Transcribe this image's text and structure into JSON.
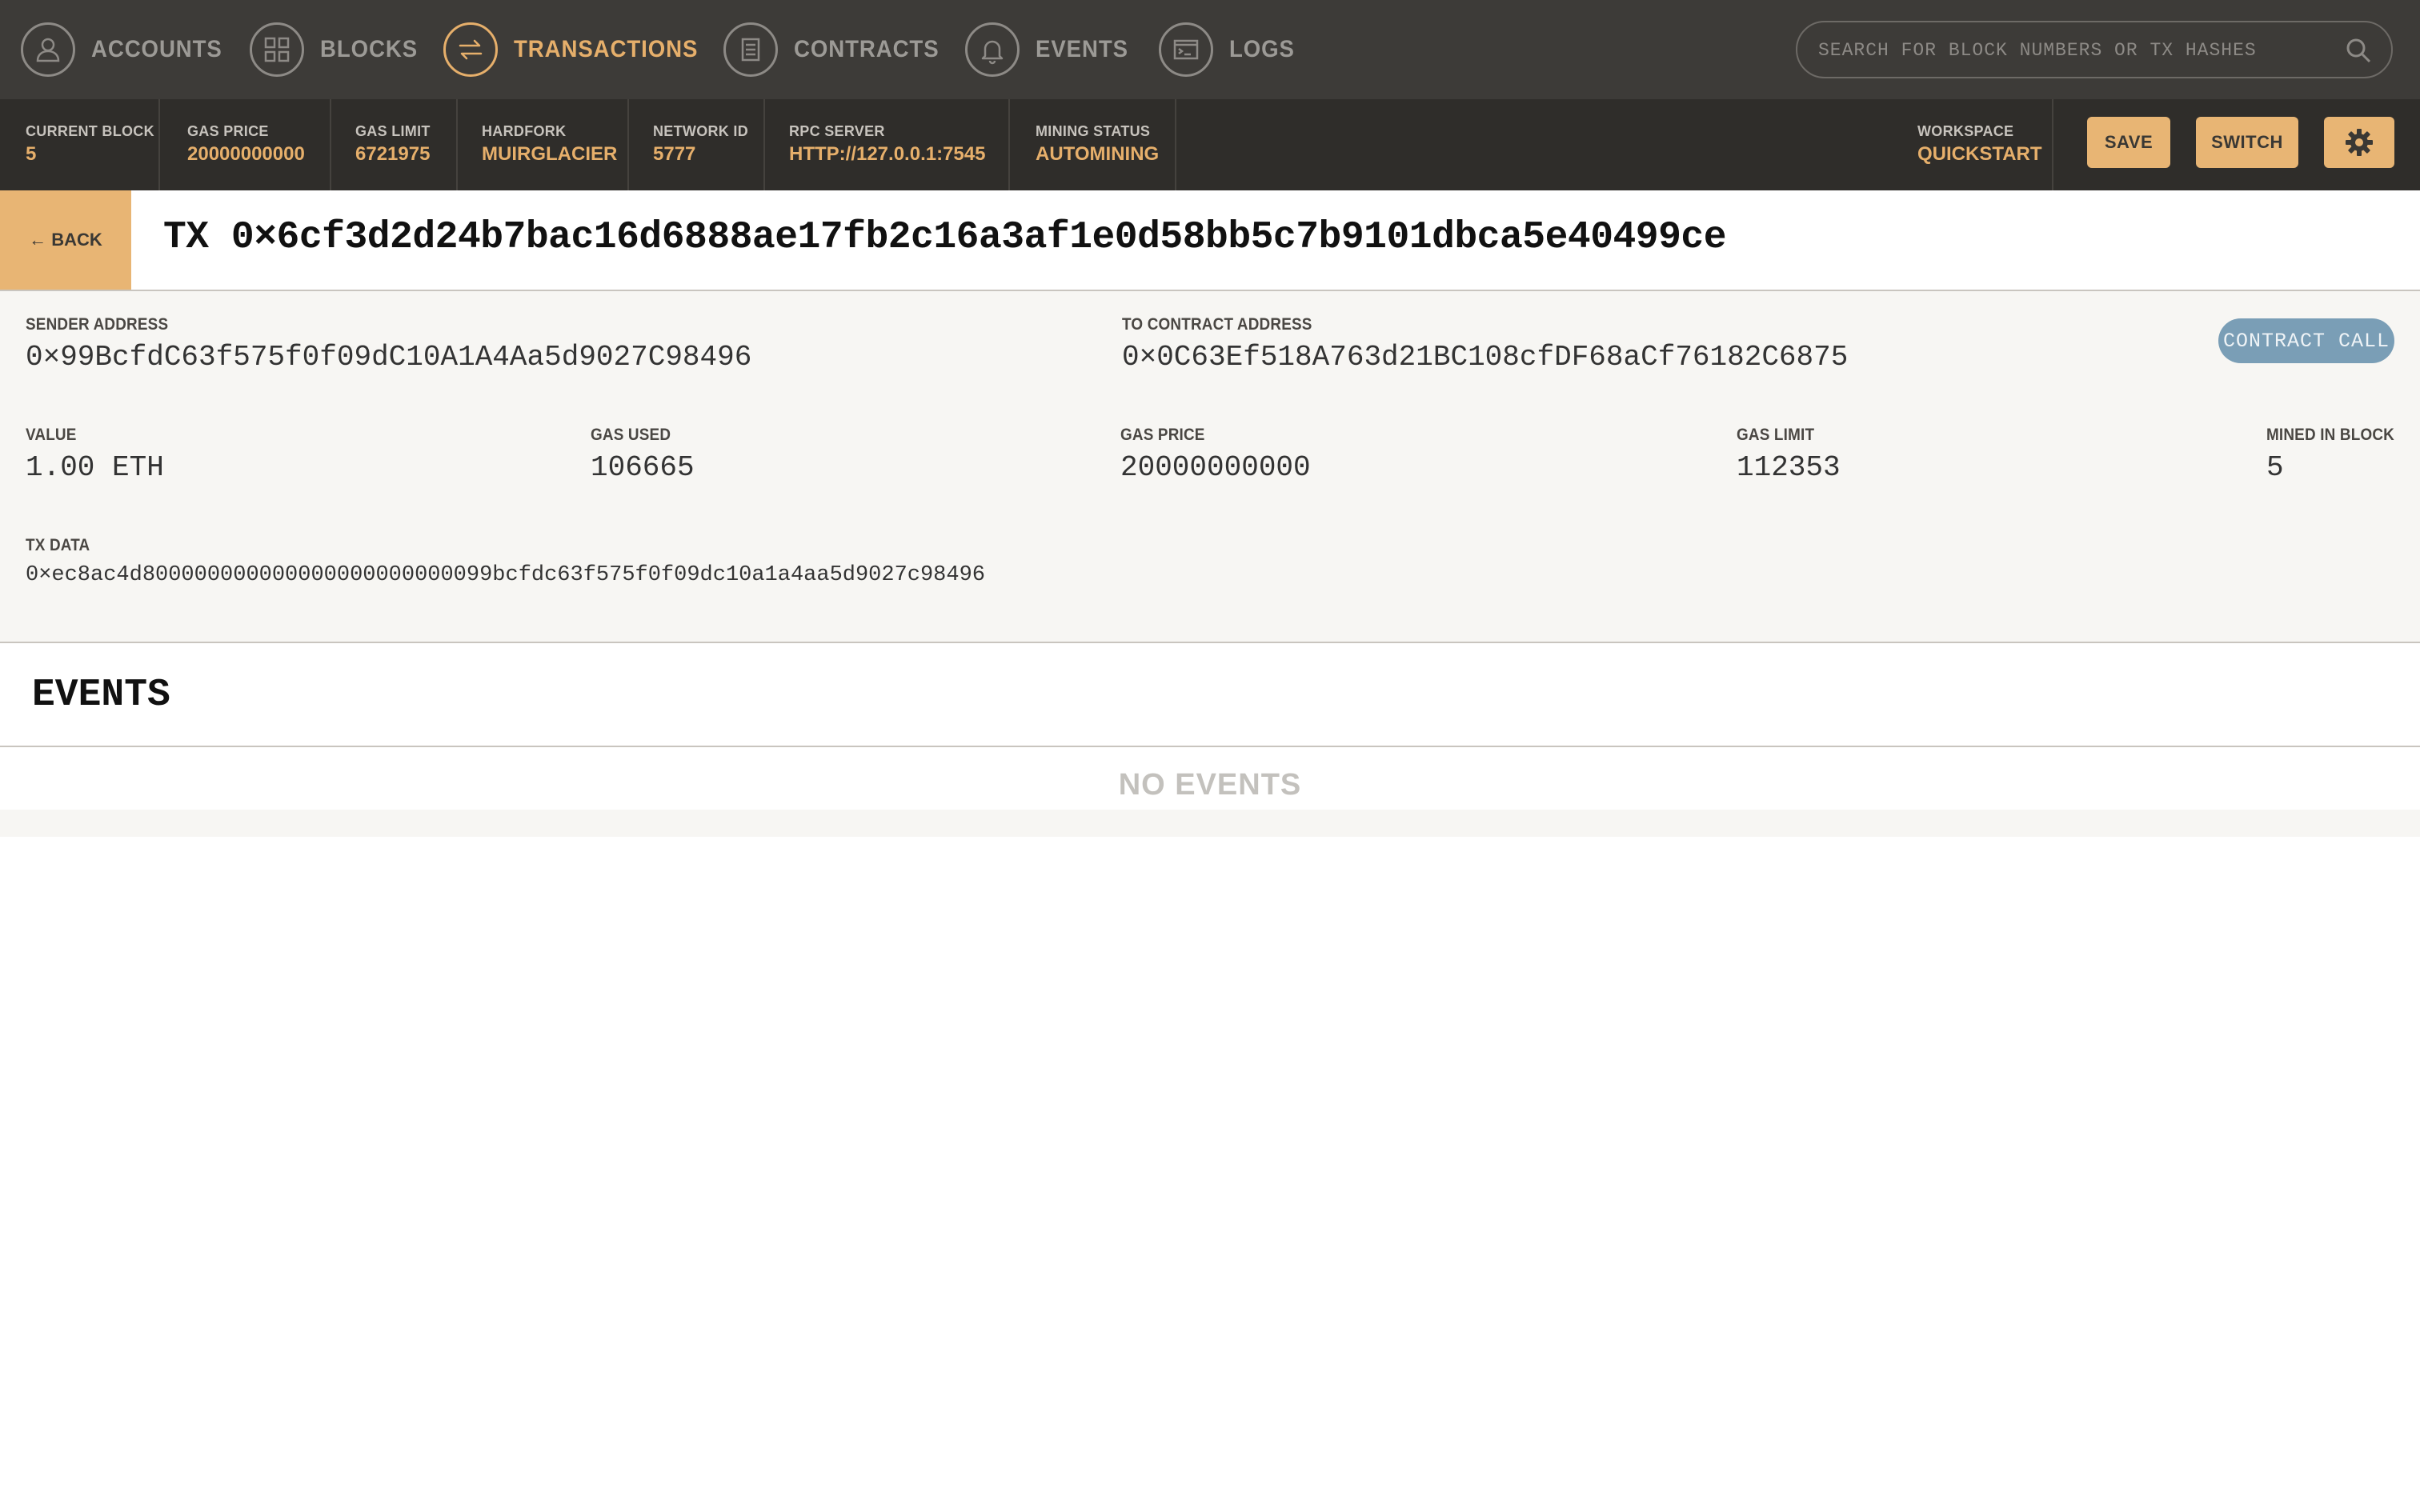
{
  "nav": {
    "items": [
      {
        "label": "ACCOUNTS",
        "icon": "account-icon"
      },
      {
        "label": "BLOCKS",
        "icon": "blocks-icon"
      },
      {
        "label": "TRANSACTIONS",
        "icon": "transactions-icon"
      },
      {
        "label": "CONTRACTS",
        "icon": "contracts-icon"
      },
      {
        "label": "EVENTS",
        "icon": "bell-icon"
      },
      {
        "label": "LOGS",
        "icon": "logs-icon"
      }
    ],
    "active": "TRANSACTIONS",
    "search_placeholder": "SEARCH FOR BLOCK NUMBERS OR TX HASHES"
  },
  "status": {
    "current_block": {
      "label": "CURRENT BLOCK",
      "value": "5"
    },
    "gas_price": {
      "label": "GAS PRICE",
      "value": "20000000000"
    },
    "gas_limit": {
      "label": "GAS LIMIT",
      "value": "6721975"
    },
    "hardfork": {
      "label": "HARDFORK",
      "value": "MUIRGLACIER"
    },
    "network_id": {
      "label": "NETWORK ID",
      "value": "5777"
    },
    "rpc_server": {
      "label": "RPC SERVER",
      "value": "HTTP://127.0.0.1:7545"
    },
    "mining_status": {
      "label": "MINING STATUS",
      "value": "AUTOMINING"
    },
    "workspace": {
      "label": "WORKSPACE",
      "value": "QUICKSTART"
    }
  },
  "buttons": {
    "save": "SAVE",
    "switch": "SWITCH"
  },
  "tx": {
    "back_label": "← BACK",
    "title": "TX 0×6cf3d2d24b7bac16d6888ae17fb2c16a3af1e0d58bb5c7b9101dbca5e40499ce",
    "sender_label": "SENDER ADDRESS",
    "sender": "0×99BcfdC63f575f0f09dC10A1A4Aa5d9027C98496",
    "to_label": "TO CONTRACT ADDRESS",
    "to": "0×0C63Ef518A763d21BC108cfDF68aCf76182C6875",
    "badge": "CONTRACT CALL",
    "value_label": "VALUE",
    "value": "1.00 ETH",
    "gas_used_label": "GAS USED",
    "gas_used": "106665",
    "gas_price_label": "GAS PRICE",
    "gas_price": "20000000000",
    "gas_limit_label": "GAS LIMIT",
    "gas_limit": "112353",
    "mined_label": "MINED IN BLOCK",
    "mined": "5",
    "data_label": "TX DATA",
    "data": "0×ec8ac4d800000000000000000000000099bcfdc63f575f0f09dc10a1a4aa5d9027c98496"
  },
  "events": {
    "title": "EVENTS",
    "empty": "NO EVENTS"
  },
  "colors": {
    "accent": "#e6af6b",
    "nav_bg": "#3d3b38",
    "status_bg": "#2f2d2a",
    "badge": "#7a9eb6"
  }
}
